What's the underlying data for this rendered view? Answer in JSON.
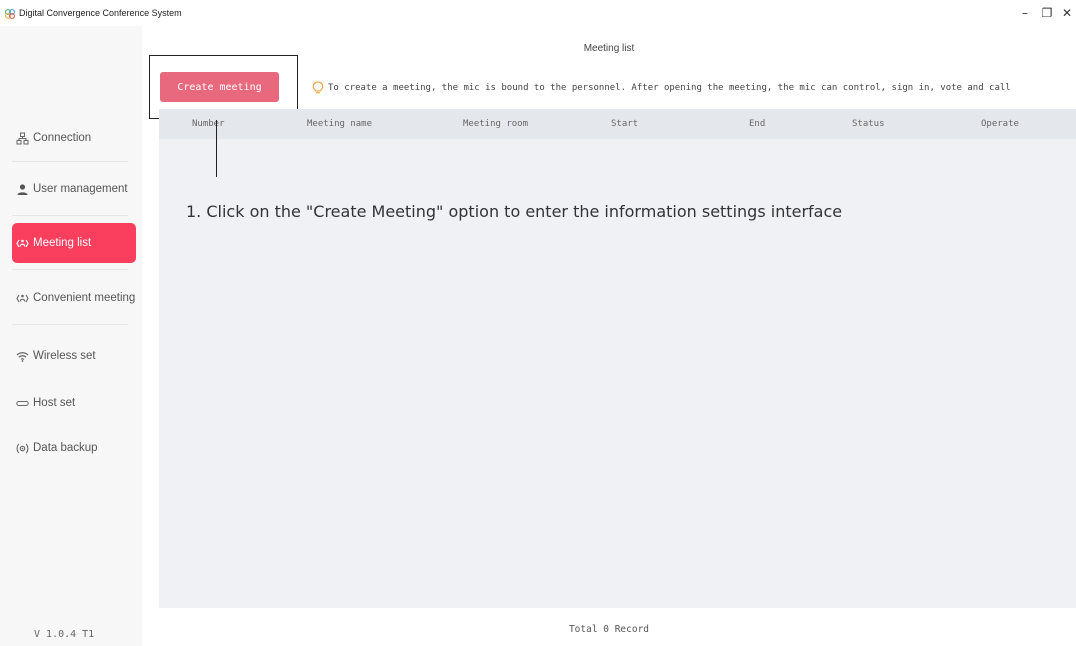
{
  "window": {
    "title": "Digital Convergence Conference System",
    "minimize_glyph": "–",
    "maximize_glyph": "❐",
    "close_glyph": "✕"
  },
  "sidebar": {
    "items": [
      {
        "label": "Connection",
        "icon": "connection-icon",
        "active": false
      },
      {
        "label": "User management",
        "icon": "user-icon",
        "active": false
      },
      {
        "label": "Meeting list",
        "icon": "meeting-icon",
        "active": true
      },
      {
        "label": "Convenient meeting",
        "icon": "convenient-meeting-icon",
        "active": false
      },
      {
        "label": "Wireless set",
        "icon": "wifi-icon",
        "active": false
      },
      {
        "label": "Host set",
        "icon": "host-icon",
        "active": false
      },
      {
        "label": "Data backup",
        "icon": "backup-icon",
        "active": false
      }
    ],
    "version": "V 1.0.4 T1"
  },
  "main": {
    "page_title": "Meeting list",
    "create_button": "Create meeting",
    "hint": "To create a meeting, the mic is bound to the personnel. After opening the meeting, the mic can control, sign in, vote and call",
    "table": {
      "columns": [
        "Number",
        "Meeting name",
        "Meeting room",
        "Start",
        "End",
        "Status",
        "Operate"
      ],
      "rows": []
    },
    "annotation": "1. Click on the \"Create Meeting\" option to enter the information settings interface",
    "footer": "Total 0 Record"
  },
  "colors": {
    "accent": "#fa3e5d",
    "button": "#e8697e",
    "hint_icon": "#f0a030",
    "table_bg": "#eff1f5",
    "header_bg": "#e4e7ec"
  }
}
